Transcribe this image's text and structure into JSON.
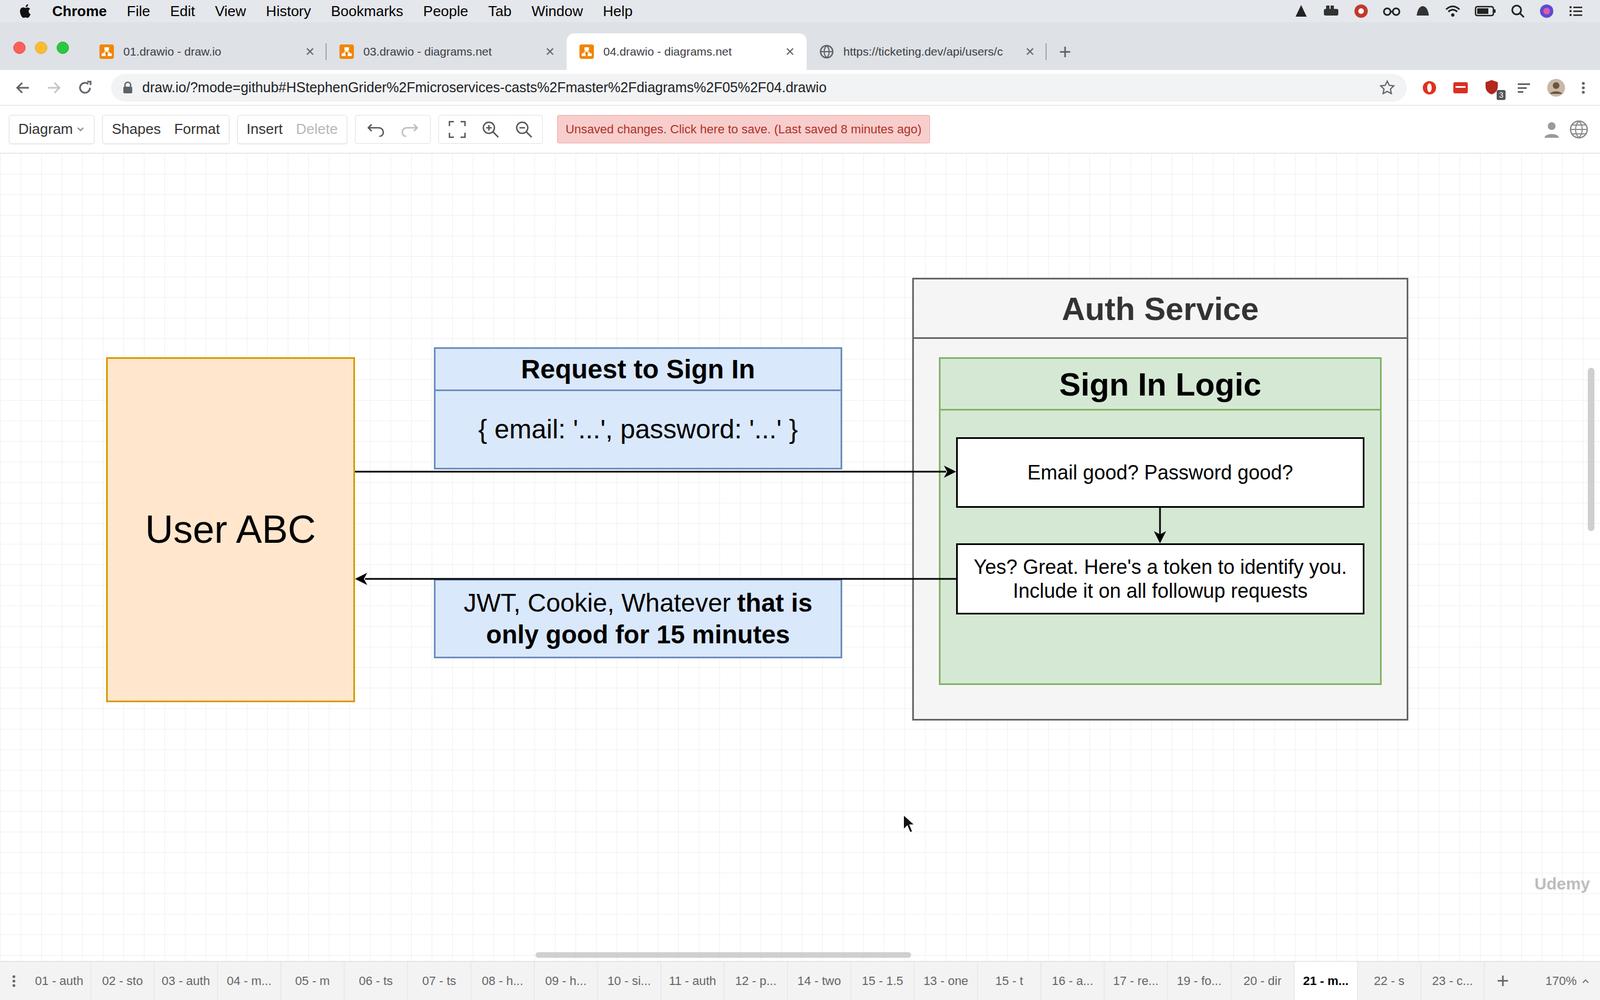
{
  "menubar": {
    "app": "Chrome",
    "items": [
      "File",
      "Edit",
      "View",
      "History",
      "Bookmarks",
      "People",
      "Tab",
      "Window",
      "Help"
    ]
  },
  "browser": {
    "tabs": [
      {
        "label": "01.drawio - draw.io",
        "selected": false,
        "kind": "drawio",
        "close": "×"
      },
      {
        "label": "03.drawio - diagrams.net",
        "selected": false,
        "kind": "drawio",
        "close": "×"
      },
      {
        "label": "04.drawio - diagrams.net",
        "selected": true,
        "kind": "drawio",
        "close": "×"
      },
      {
        "label": "https://ticketing.dev/api/users/c",
        "selected": false,
        "kind": "web",
        "close": "×"
      }
    ],
    "new_tab": "+",
    "url": "draw.io/?mode=github#HStephenGrider%2Fmicroservices-casts%2Fmaster%2Fdiagrams%2F05%2F04.drawio",
    "extension_badge": "3"
  },
  "toolbar": {
    "groups": [
      [
        {
          "label": "Diagram",
          "disabled": false
        }
      ],
      [
        {
          "label": "Shapes",
          "disabled": false
        },
        {
          "label": "Format",
          "disabled": false
        }
      ],
      [
        {
          "label": "Insert",
          "disabled": false
        },
        {
          "label": "Delete",
          "disabled": true
        }
      ]
    ],
    "save_notice": "Unsaved changes. Click here to save. (Last saved 8 minutes ago)"
  },
  "diagram": {
    "user": {
      "label": "User ABC"
    },
    "request": {
      "title": "Request to Sign In",
      "body": "{ email: '...', password: '...' }"
    },
    "response": {
      "text": "JWT, Cookie, Whatever",
      "emphasis": "that is only good for 15 minutes"
    },
    "service": {
      "title": "Auth Service",
      "logic": {
        "title": "Sign In Logic",
        "steps": [
          {
            "lines": [
              "Email good? Password good?"
            ]
          },
          {
            "lines": [
              "Yes? Great. Here's a token to identify you.",
              "Include it on all followup requests"
            ]
          }
        ]
      }
    },
    "watermark": "Udemy"
  },
  "pages": {
    "items": [
      {
        "label": "01 - auth",
        "selected": false
      },
      {
        "label": "02 - sto",
        "selected": false
      },
      {
        "label": "03 - auth",
        "selected": false
      },
      {
        "label": "04 - m...",
        "selected": false
      },
      {
        "label": "05 - m",
        "selected": false
      },
      {
        "label": "06 - ts",
        "selected": false
      },
      {
        "label": "07 - ts",
        "selected": false
      },
      {
        "label": "08 - h...",
        "selected": false
      },
      {
        "label": "09 - h...",
        "selected": false
      },
      {
        "label": "10 - si...",
        "selected": false
      },
      {
        "label": "11 - auth",
        "selected": false
      },
      {
        "label": "12 - p...",
        "selected": false
      },
      {
        "label": "14 - two",
        "selected": false
      },
      {
        "label": "15 - 1.5",
        "selected": false
      },
      {
        "label": "13 - one",
        "selected": false
      },
      {
        "label": "15 - t",
        "selected": false
      },
      {
        "label": "16 - a...",
        "selected": false
      },
      {
        "label": "17 - re...",
        "selected": false
      },
      {
        "label": "19 - fo...",
        "selected": false
      },
      {
        "label": "20 - dir",
        "selected": false
      },
      {
        "label": "21 - m...",
        "selected": true
      },
      {
        "label": "22 - s",
        "selected": false
      },
      {
        "label": "23 - c...",
        "selected": false
      }
    ],
    "add": "+",
    "zoom": "170%"
  }
}
